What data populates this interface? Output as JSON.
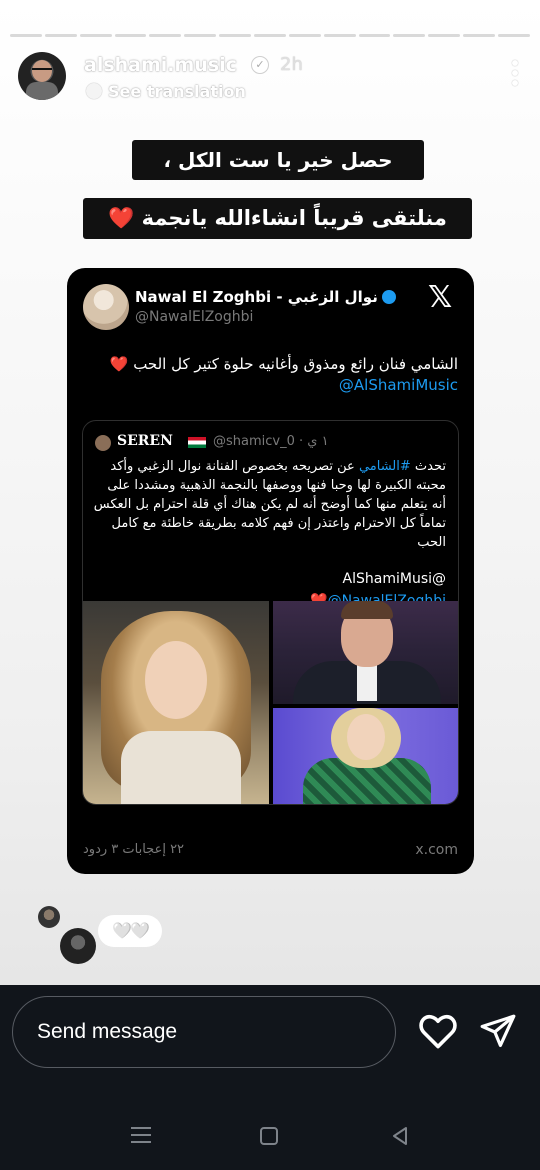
{
  "story": {
    "progress_segments": 15,
    "username": "alshami.music",
    "time": "2h",
    "see_translation": "See translation",
    "caption_line1": "حصل خير يا ست الكل ،",
    "caption_line2": "منلتقى قريباً انشاءالله يانجمة",
    "caption_heart": "❤️"
  },
  "tweet": {
    "author_name": "Nawal El Zoghbi - نوال الزغبي",
    "author_handle": "@NawalElZoghbi",
    "text": "الشامي فنان رائع ومذوق وأغانيه حلوة كتير كل الحب ❤️",
    "mention": "@AlShamiMusic",
    "quoted": {
      "name": "SEREN",
      "handle": "@shamicv_0 · ١ ي",
      "text_prefix": "تحدث ",
      "hashtag": "#الشامي",
      "text_rest": " عن تصريحه بخصوص الفنانة نوال الزغبي وأكد محبته الكبيرة لها وحبا فنها ووصفها بالنجمة الذهبية ومشددا على أنه يتعلم منها كما أوضح أنه لم يكن هناك أي قلة احترام بل العكس تماماً كل الاحترام واعتذر إن فهم كلامه بطريقة خاطئة مع كامل الحب",
      "mention_plain": "AlShamiMusi@",
      "mention_blue": "❤️@NawalElZoghbi"
    },
    "stats": "٢٢ إعجابات ٣ ردود",
    "domain": "x.com"
  },
  "reactions": {
    "pill": "🤍🤍"
  },
  "composer": {
    "placeholder": "Send message"
  },
  "colors": {
    "tweet_link": "#1d9bf0",
    "composer_bg": "#11151b",
    "heart_red": "#e0223a"
  },
  "icons": [
    "verified-icon",
    "translate-icon",
    "more-icon",
    "x-logo-icon",
    "heart-icon",
    "send-icon",
    "nav-menu-icon",
    "nav-home-icon",
    "nav-back-icon"
  ]
}
